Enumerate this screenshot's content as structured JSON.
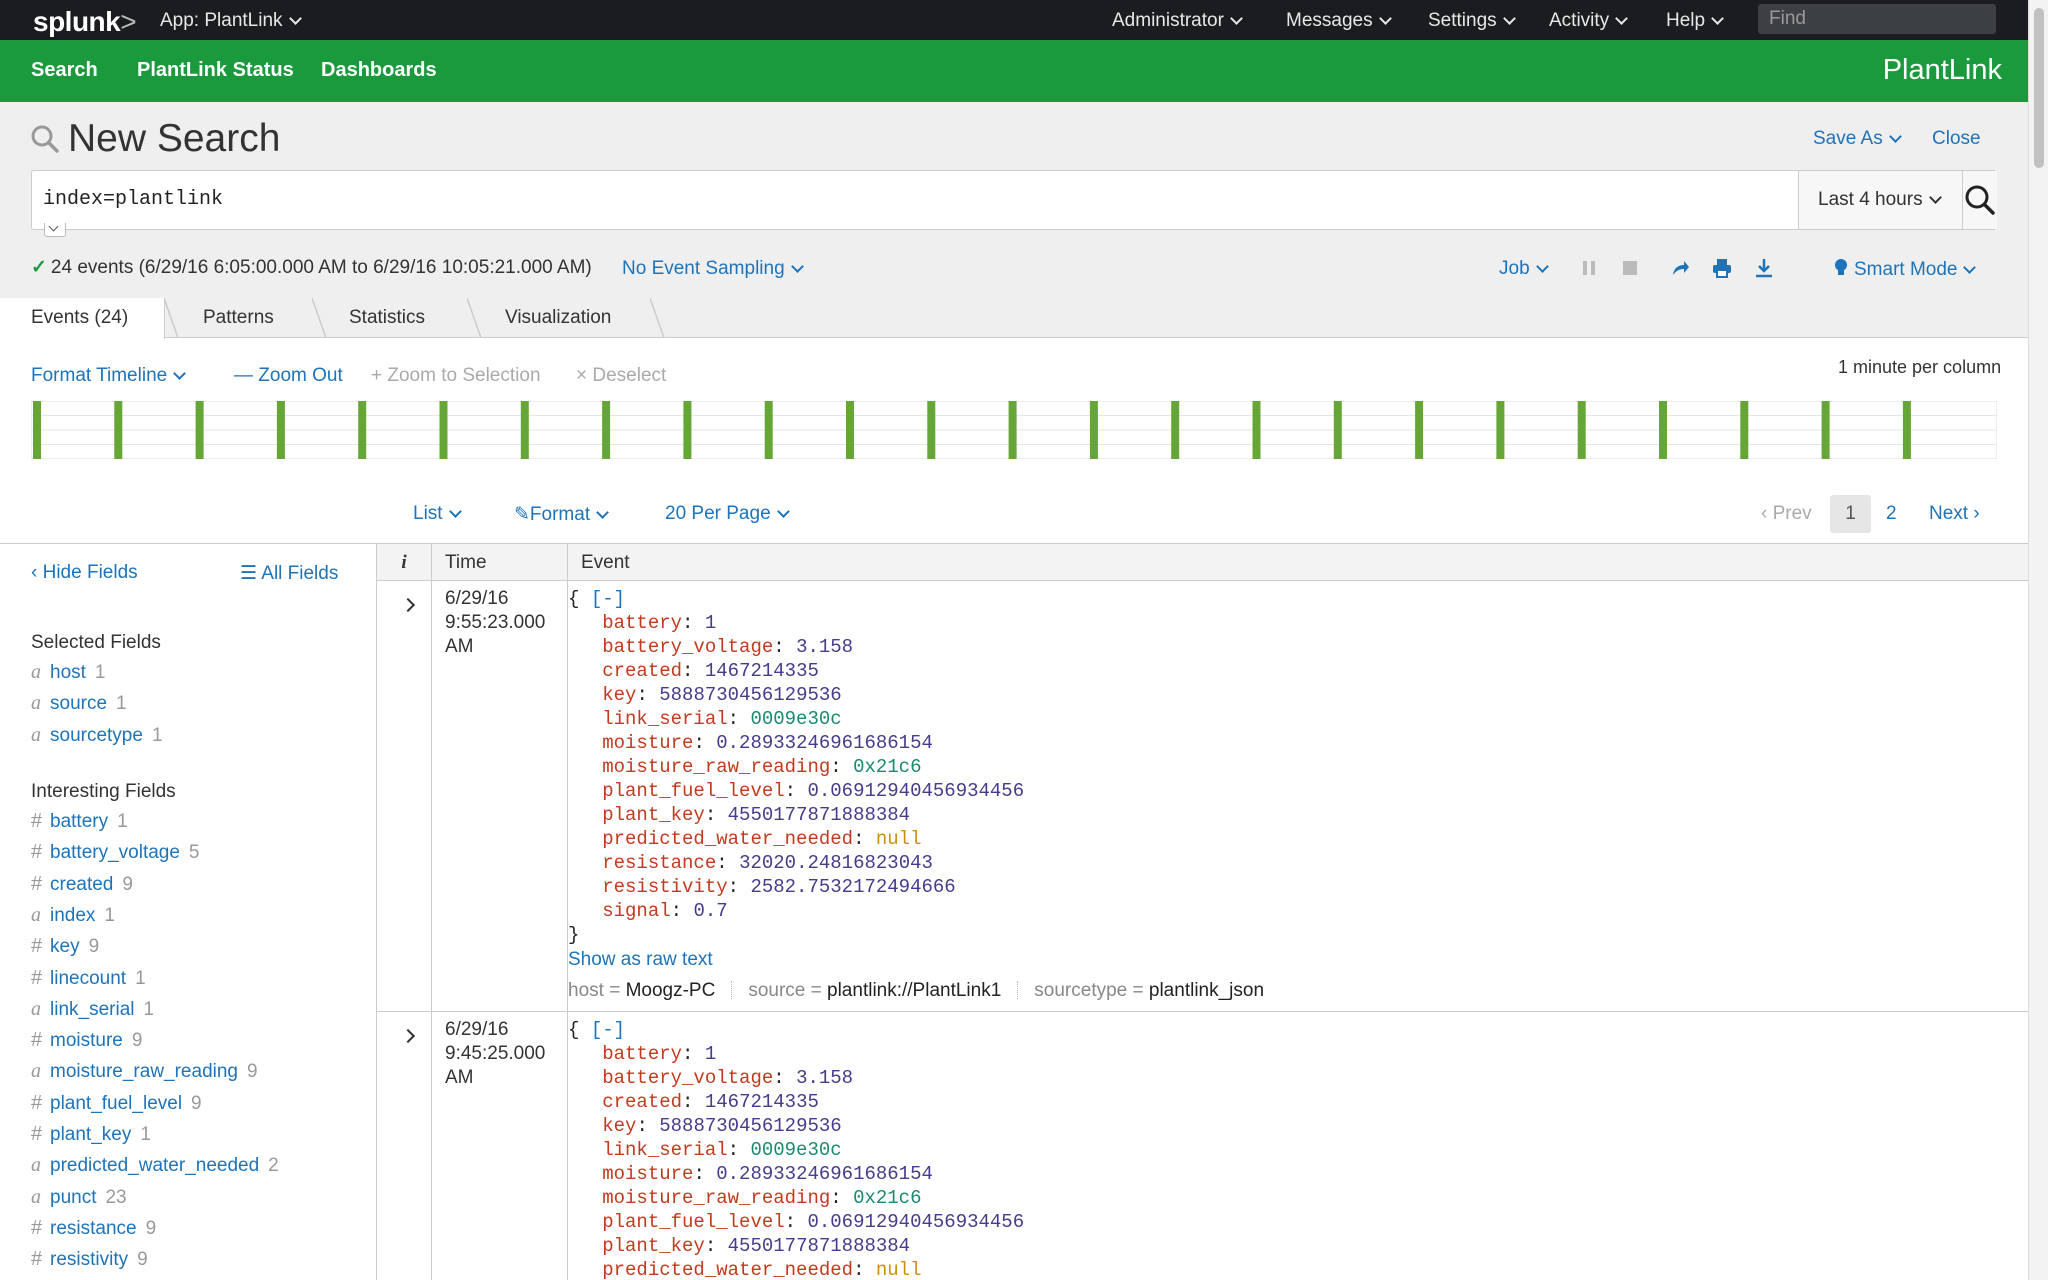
{
  "topbar": {
    "logo": "splunk",
    "logo_suffix": ">",
    "app_menu": "App: PlantLink",
    "menus": [
      "Administrator",
      "Messages",
      "Settings",
      "Activity",
      "Help"
    ],
    "find_placeholder": "Find"
  },
  "nav": {
    "items": [
      "Search",
      "PlantLink Status",
      "Dashboards"
    ],
    "app_title": "PlantLink"
  },
  "search": {
    "title": "New Search",
    "save_as": "Save As",
    "close": "Close",
    "query": "index=plantlink",
    "time_range": "Last 4 hours",
    "status": "24 events (6/29/16 6:05:00.000 AM to 6/29/16 10:05:21.000 AM)",
    "sampling": "No Event Sampling",
    "job": "Job",
    "mode": "Smart Mode"
  },
  "tabs": [
    "Events (24)",
    "Patterns",
    "Statistics",
    "Visualization"
  ],
  "timeline": {
    "format": "Format Timeline",
    "zoom_out": "Zoom Out",
    "zoom_selection": "Zoom to Selection",
    "deselect": "Deselect",
    "scale": "1 minute per column",
    "bar_count": 24,
    "color": "#65a637"
  },
  "results_toolbar": {
    "list": "List",
    "format": "Format",
    "per_page": "20 Per Page",
    "prev": "Prev",
    "pages": [
      "1",
      "2"
    ],
    "next": "Next"
  },
  "sidebar": {
    "hide_fields": "Hide Fields",
    "all_fields": "All Fields",
    "selected_heading": "Selected Fields",
    "selected": [
      {
        "type": "a",
        "name": "host",
        "count": "1"
      },
      {
        "type": "a",
        "name": "source",
        "count": "1"
      },
      {
        "type": "a",
        "name": "sourcetype",
        "count": "1"
      }
    ],
    "interesting_heading": "Interesting Fields",
    "interesting": [
      {
        "type": "#",
        "name": "battery",
        "count": "1"
      },
      {
        "type": "#",
        "name": "battery_voltage",
        "count": "5"
      },
      {
        "type": "#",
        "name": "created",
        "count": "9"
      },
      {
        "type": "a",
        "name": "index",
        "count": "1"
      },
      {
        "type": "#",
        "name": "key",
        "count": "9"
      },
      {
        "type": "#",
        "name": "linecount",
        "count": "1"
      },
      {
        "type": "a",
        "name": "link_serial",
        "count": "1"
      },
      {
        "type": "#",
        "name": "moisture",
        "count": "9"
      },
      {
        "type": "a",
        "name": "moisture_raw_reading",
        "count": "9"
      },
      {
        "type": "#",
        "name": "plant_fuel_level",
        "count": "9"
      },
      {
        "type": "#",
        "name": "plant_key",
        "count": "1"
      },
      {
        "type": "a",
        "name": "predicted_water_needed",
        "count": "2"
      },
      {
        "type": "a",
        "name": "punct",
        "count": "23"
      },
      {
        "type": "#",
        "name": "resistance",
        "count": "9"
      },
      {
        "type": "#",
        "name": "resistivity",
        "count": "9"
      }
    ]
  },
  "table": {
    "headers": [
      "i",
      "Time",
      "Event"
    ],
    "show_raw": "Show as raw text",
    "events": [
      {
        "date": "6/29/16",
        "time": "9:55:23.000 AM",
        "fields": [
          {
            "k": "battery",
            "v": "1",
            "t": "n"
          },
          {
            "k": "battery_voltage",
            "v": "3.158",
            "t": "n"
          },
          {
            "k": "created",
            "v": "1467214335",
            "t": "n"
          },
          {
            "k": "key",
            "v": "5888730456129536",
            "t": "n"
          },
          {
            "k": "link_serial",
            "v": "0009e30c",
            "t": "s"
          },
          {
            "k": "moisture",
            "v": "0.28933246961686154",
            "t": "n"
          },
          {
            "k": "moisture_raw_reading",
            "v": "0x21c6",
            "t": "s"
          },
          {
            "k": "plant_fuel_level",
            "v": "0.06912940456934456",
            "t": "n"
          },
          {
            "k": "plant_key",
            "v": "4550177871888384",
            "t": "n"
          },
          {
            "k": "predicted_water_needed",
            "v": "null",
            "t": "nul"
          },
          {
            "k": "resistance",
            "v": "32020.24816823043",
            "t": "n"
          },
          {
            "k": "resistivity",
            "v": "2582.7532172494666",
            "t": "n"
          },
          {
            "k": "signal",
            "v": "0.7",
            "t": "n"
          }
        ],
        "meta": {
          "host": "Moogz-PC",
          "source": "plantlink://PlantLink1",
          "sourcetype": "plantlink_json"
        }
      },
      {
        "date": "6/29/16",
        "time": "9:45:25.000 AM",
        "fields": [
          {
            "k": "battery",
            "v": "1",
            "t": "n"
          },
          {
            "k": "battery_voltage",
            "v": "3.158",
            "t": "n"
          },
          {
            "k": "created",
            "v": "1467214335",
            "t": "n"
          },
          {
            "k": "key",
            "v": "5888730456129536",
            "t": "n"
          },
          {
            "k": "link_serial",
            "v": "0009e30c",
            "t": "s"
          },
          {
            "k": "moisture",
            "v": "0.28933246961686154",
            "t": "n"
          },
          {
            "k": "moisture_raw_reading",
            "v": "0x21c6",
            "t": "s"
          },
          {
            "k": "plant_fuel_level",
            "v": "0.06912940456934456",
            "t": "n"
          },
          {
            "k": "plant_key",
            "v": "4550177871888384",
            "t": "n"
          },
          {
            "k": "predicted_water_needed",
            "v": "null",
            "t": "nul"
          }
        ]
      }
    ]
  },
  "colors": {
    "topbar": "#1a1c20",
    "nav": "#1a9a3c",
    "link": "#1e73b9",
    "json_key": "#c33a1e",
    "json_number": "#4a3a8c",
    "json_string": "#1a8a6e",
    "json_null": "#d08f0a"
  }
}
